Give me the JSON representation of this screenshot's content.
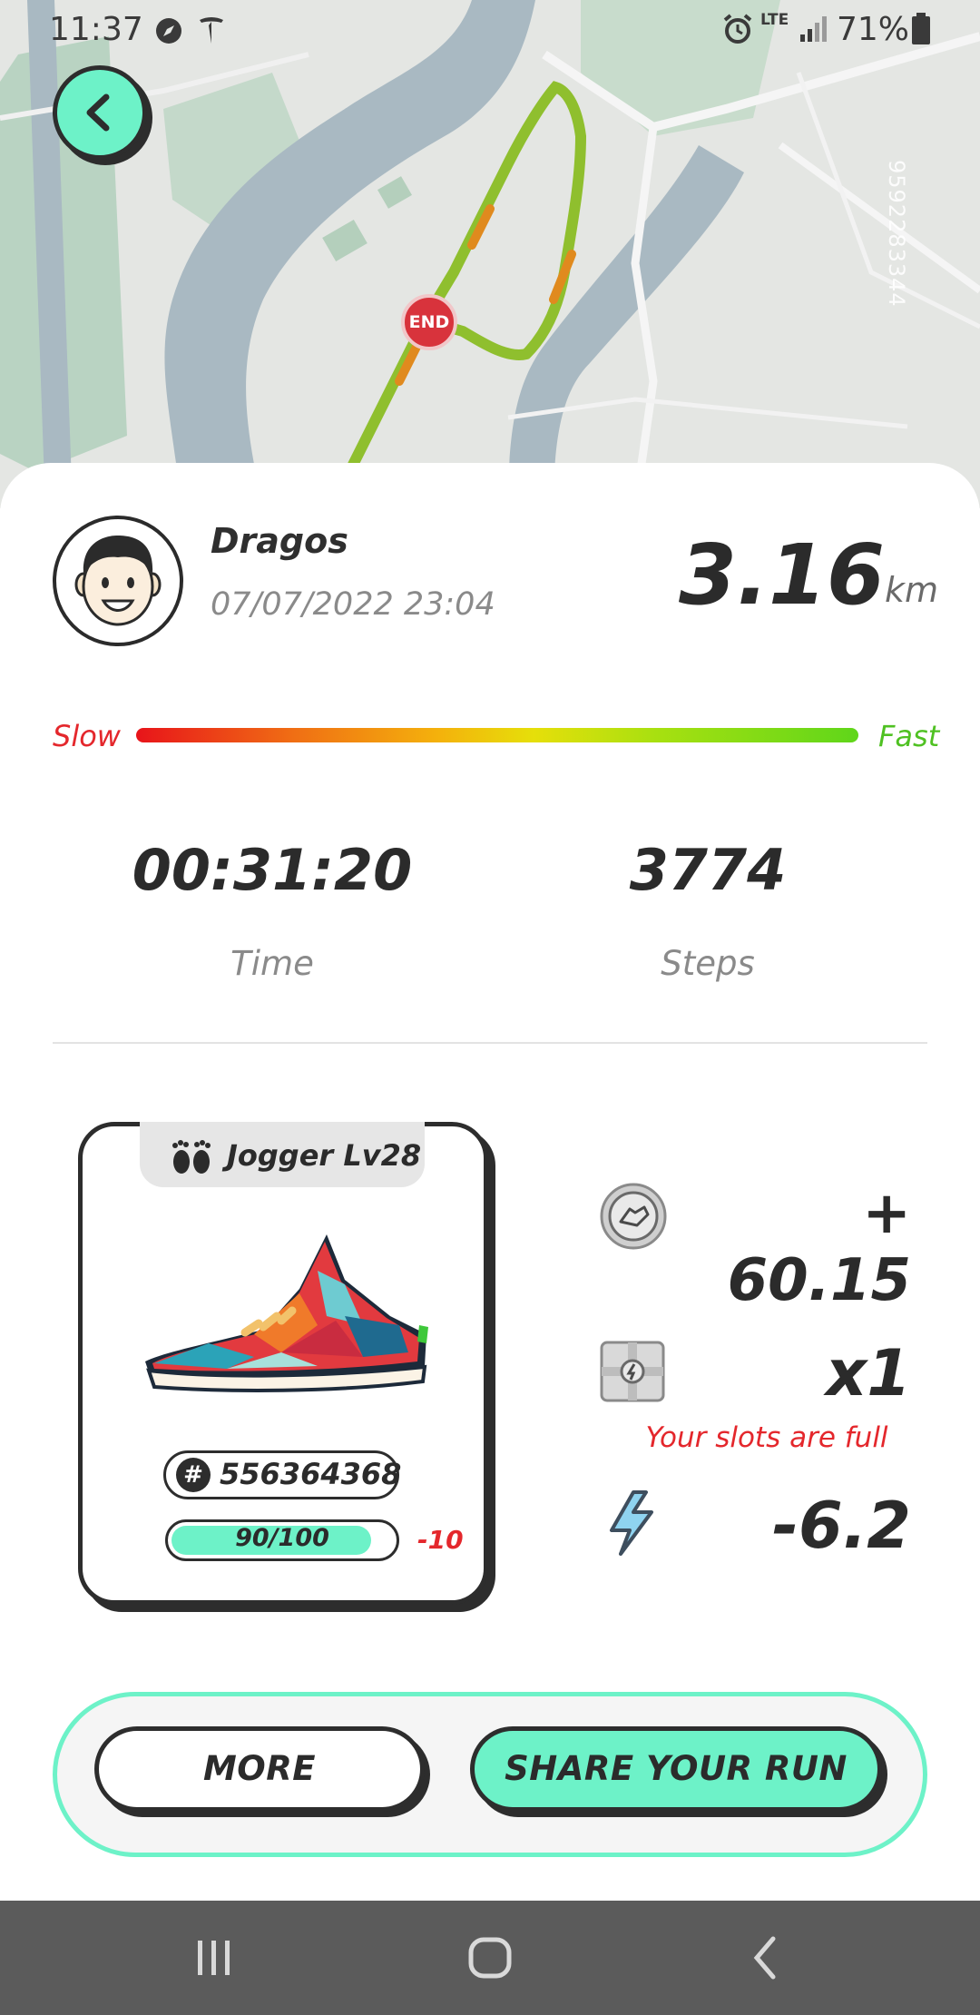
{
  "status_bar": {
    "time": "11:37",
    "network": "LTE",
    "battery": "71%"
  },
  "map": {
    "id_text": "9592283344",
    "end_marker": "END"
  },
  "run": {
    "user_name": "Dragos",
    "datetime": "07/07/2022 23:04",
    "distance": "3.16",
    "distance_unit": "km",
    "speed_slow_label": "Slow",
    "speed_fast_label": "Fast",
    "time_value": "00:31:20",
    "time_label": "Time",
    "steps_value": "3774",
    "steps_label": "Steps"
  },
  "sneaker": {
    "type_label": "Jogger Lv28",
    "id": "556364368",
    "durability_text": "90/100",
    "durability_fraction": 0.9,
    "durability_delta": "-10"
  },
  "rewards": {
    "coins": "+ 60.15",
    "mystery_box": "x1",
    "slots_full": "Your slots are full",
    "energy": "-6.2"
  },
  "actions": {
    "more_label": "MORE",
    "share_label": "SHARE YOUR RUN"
  },
  "colors": {
    "accent": "#6df2c8",
    "slow": "#e4272c",
    "fast": "#4fc122",
    "dark": "#2d2d2d"
  },
  "icons": {
    "back": "arrow-left-icon",
    "coin": "coin-icon",
    "box": "mystery-box-icon",
    "energy": "lightning-icon"
  }
}
